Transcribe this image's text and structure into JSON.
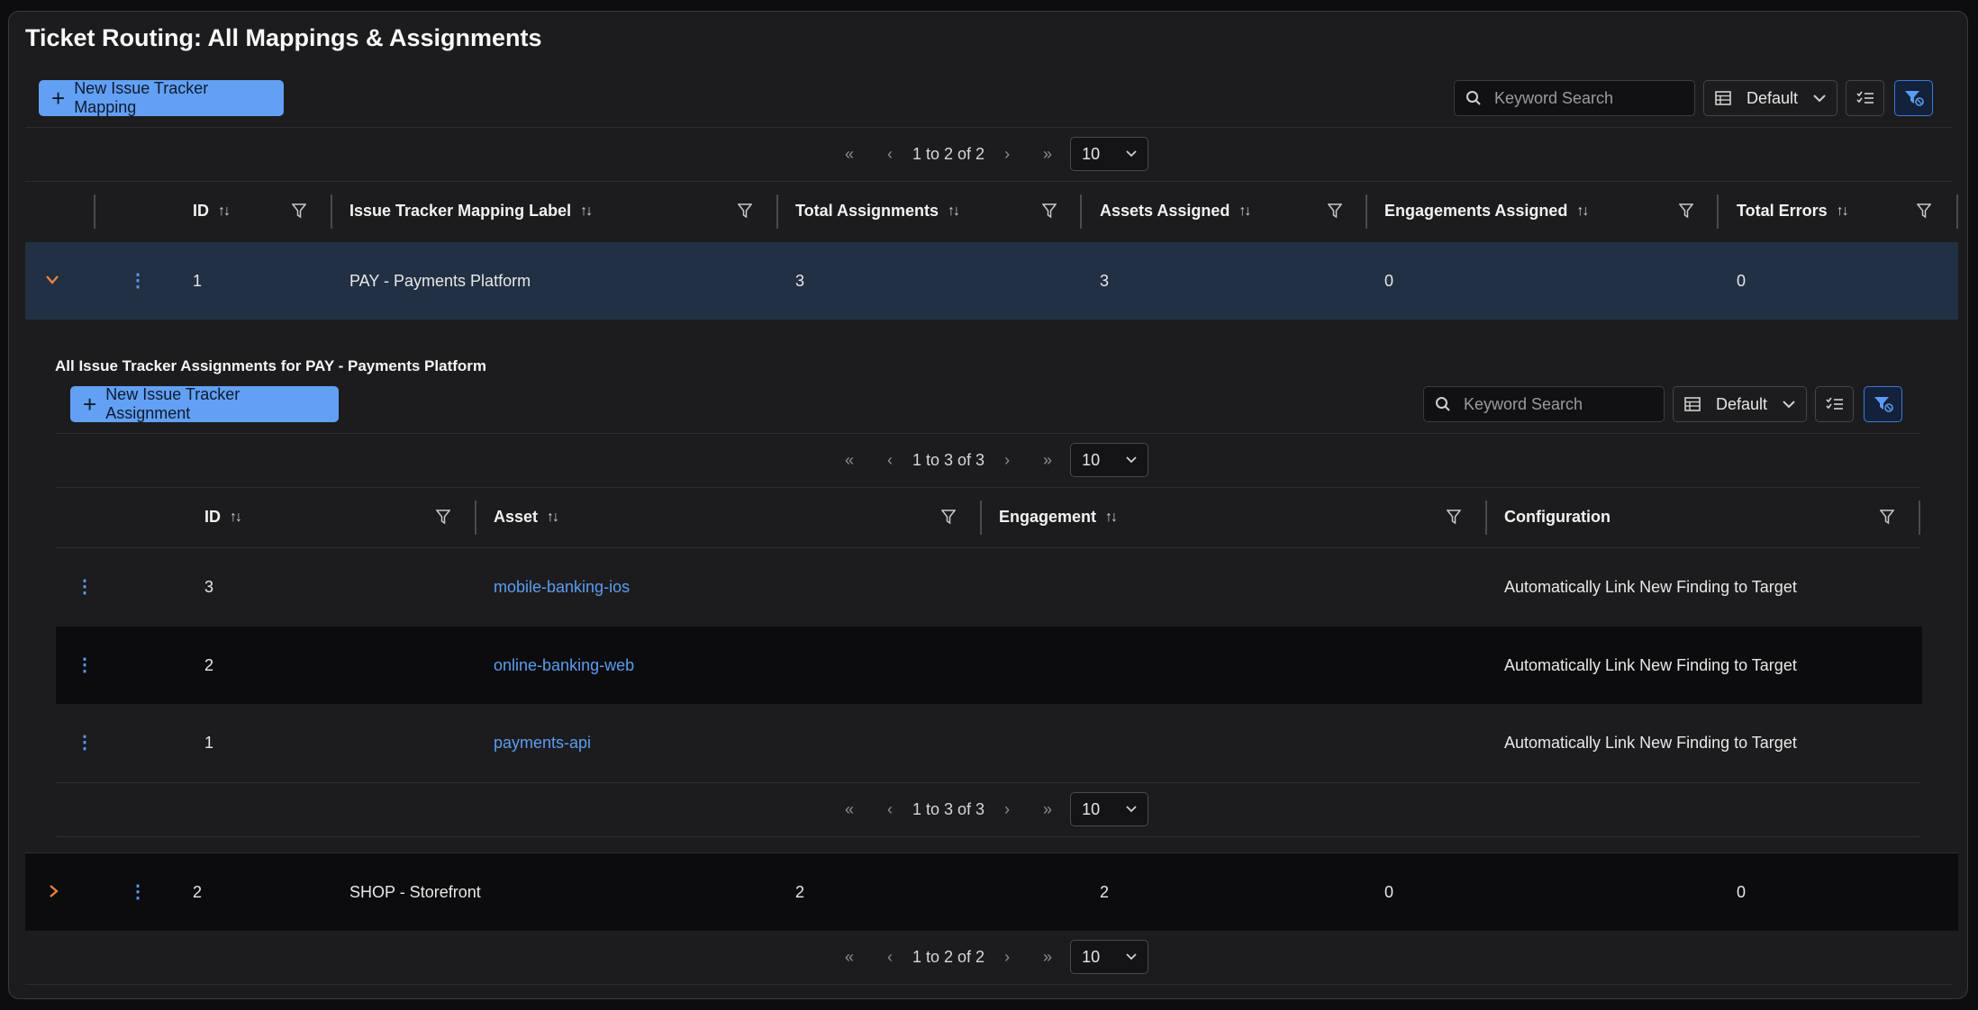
{
  "page": {
    "title": "Ticket Routing: All Mappings & Assignments"
  },
  "toolbar": {
    "new_button": "New Issue Tracker Mapping",
    "search_placeholder": "Keyword Search",
    "view_select": "Default"
  },
  "pagination_top": {
    "range": "1 to 2 of 2",
    "page_size": "10"
  },
  "pagination_bottom": {
    "range": "1 to 2 of 2",
    "page_size": "10"
  },
  "table": {
    "columns": [
      "ID",
      "Issue Tracker Mapping Label",
      "Total Assignments",
      "Assets Assigned",
      "Engagements Assigned",
      "Total Errors"
    ],
    "rows": [
      {
        "id": "1",
        "label": "PAY - Payments Platform",
        "total_assignments": "3",
        "assets_assigned": "3",
        "engagements_assigned": "0",
        "total_errors": "0",
        "expanded": true
      },
      {
        "id": "2",
        "label": "SHOP - Storefront",
        "total_assignments": "2",
        "assets_assigned": "2",
        "engagements_assigned": "0",
        "total_errors": "0",
        "expanded": false
      }
    ]
  },
  "subtable": {
    "title": "All Issue Tracker Assignments for PAY - Payments Platform",
    "new_button": "New Issue Tracker Assignment",
    "search_placeholder": "Keyword Search",
    "view_select": "Default",
    "pagination_top": {
      "range": "1 to 3 of 3",
      "page_size": "10"
    },
    "pagination_bottom": {
      "range": "1 to 3 of 3",
      "page_size": "10"
    },
    "columns": [
      "ID",
      "Asset",
      "Engagement",
      "Configuration"
    ],
    "rows": [
      {
        "id": "3",
        "asset": "mobile-banking-ios",
        "engagement": "",
        "configuration": "Automatically Link New Finding to Target"
      },
      {
        "id": "2",
        "asset": "online-banking-web",
        "engagement": "",
        "configuration": "Automatically Link New Finding to Target"
      },
      {
        "id": "1",
        "asset": "payments-api",
        "engagement": "",
        "configuration": "Automatically Link New Finding to Target"
      }
    ]
  },
  "colors": {
    "accent": "#62a0f4",
    "link": "#5b9cf0",
    "chevron": "#f0843c",
    "background": "#1c1c1e"
  }
}
